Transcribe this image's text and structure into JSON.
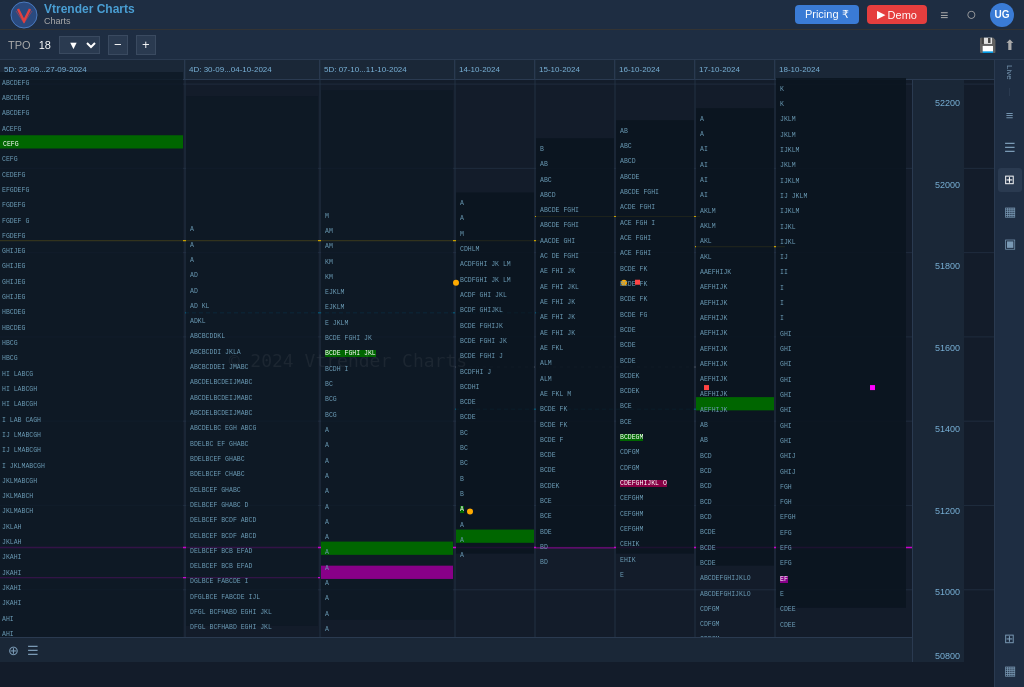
{
  "header": {
    "logo_text": "Vtrender\nCharts",
    "pricing_label": "Pricing ₹",
    "demo_label": "Demo",
    "demo_icon": "▶",
    "menu_icon": "≡",
    "user_icon": "UG"
  },
  "toolbar": {
    "tpo_label": "TPO",
    "tpo_value": "18",
    "minus_label": "−",
    "plus_label": "+",
    "save_label": "💾",
    "download_label": "⬇"
  },
  "chart": {
    "watermark": "© 2024 Vtrender Charts",
    "date_sections": [
      "5D: 23-09...27-09-2024",
      "4D: 30-09...04-10-2024",
      "5D: 07-10...11-10-2024",
      "14-10-2024",
      "15-10-2024",
      "16-10-2024",
      "17-10-2024",
      "18-10-2024"
    ],
    "price_levels": [
      {
        "value": "52200",
        "pct": 4
      },
      {
        "value": "52000",
        "pct": 18
      },
      {
        "value": "51800",
        "pct": 32
      },
      {
        "value": "51600",
        "pct": 46
      },
      {
        "value": "51400",
        "pct": 60
      },
      {
        "value": "51200",
        "pct": 74
      },
      {
        "value": "51000",
        "pct": 88
      }
    ]
  },
  "right_panel": {
    "live_label": "Live",
    "icons": [
      "≡",
      "☰",
      "⊞",
      "▦",
      "▣"
    ]
  },
  "bottom_toolbar": {
    "icon1": "⊕",
    "icon2": "≡"
  }
}
